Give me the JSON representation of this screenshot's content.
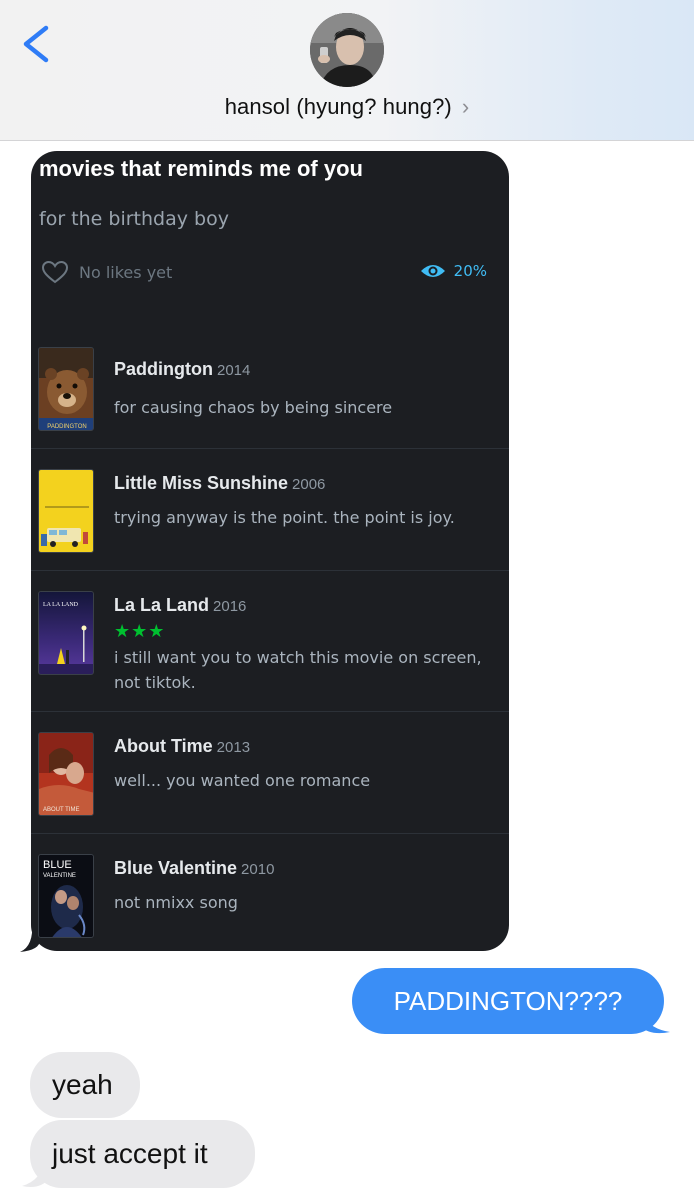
{
  "header": {
    "contact_name": "hansol (hyung? hung?)",
    "chevron": "›"
  },
  "card": {
    "title": "movies that reminds me of you",
    "subtitle": "for the birthday boy",
    "likes_text": "No likes yet",
    "watched_percent": "20%",
    "films": [
      {
        "title": "Paddington",
        "year": "2014",
        "note": "for causing chaos by being sincere",
        "stars": ""
      },
      {
        "title": "Little Miss Sunshine",
        "year": "2006",
        "note": "trying anyway is the point. the point is joy.",
        "stars": ""
      },
      {
        "title": "La La Land",
        "year": "2016",
        "note": "i still want you to watch this movie on screen, not tiktok.",
        "stars": "★★★"
      },
      {
        "title": "About Time",
        "year": "2013",
        "note": "well... you wanted one romance",
        "stars": ""
      },
      {
        "title": "Blue Valentine",
        "year": "2010",
        "note": "not nmixx song",
        "stars": ""
      }
    ],
    "poster_texts": {
      "paddington": "PADDINGTON",
      "lalaland": "LA LA LAND",
      "abouttime": "ABOUT TIME",
      "bluevalentine_1": "BLUE",
      "bluevalentine_2": "VALENTINE"
    }
  },
  "messages": {
    "sent_1": "PADDINGTON????",
    "received_1": "yeah",
    "received_2": "just accept it"
  },
  "colors": {
    "imessage_blue": "#3a8ef6",
    "received_gray": "#e9e9eb",
    "card_bg": "#1c1e22",
    "letterboxd_green": "#00c030",
    "letterboxd_blue": "#40bcf4"
  }
}
